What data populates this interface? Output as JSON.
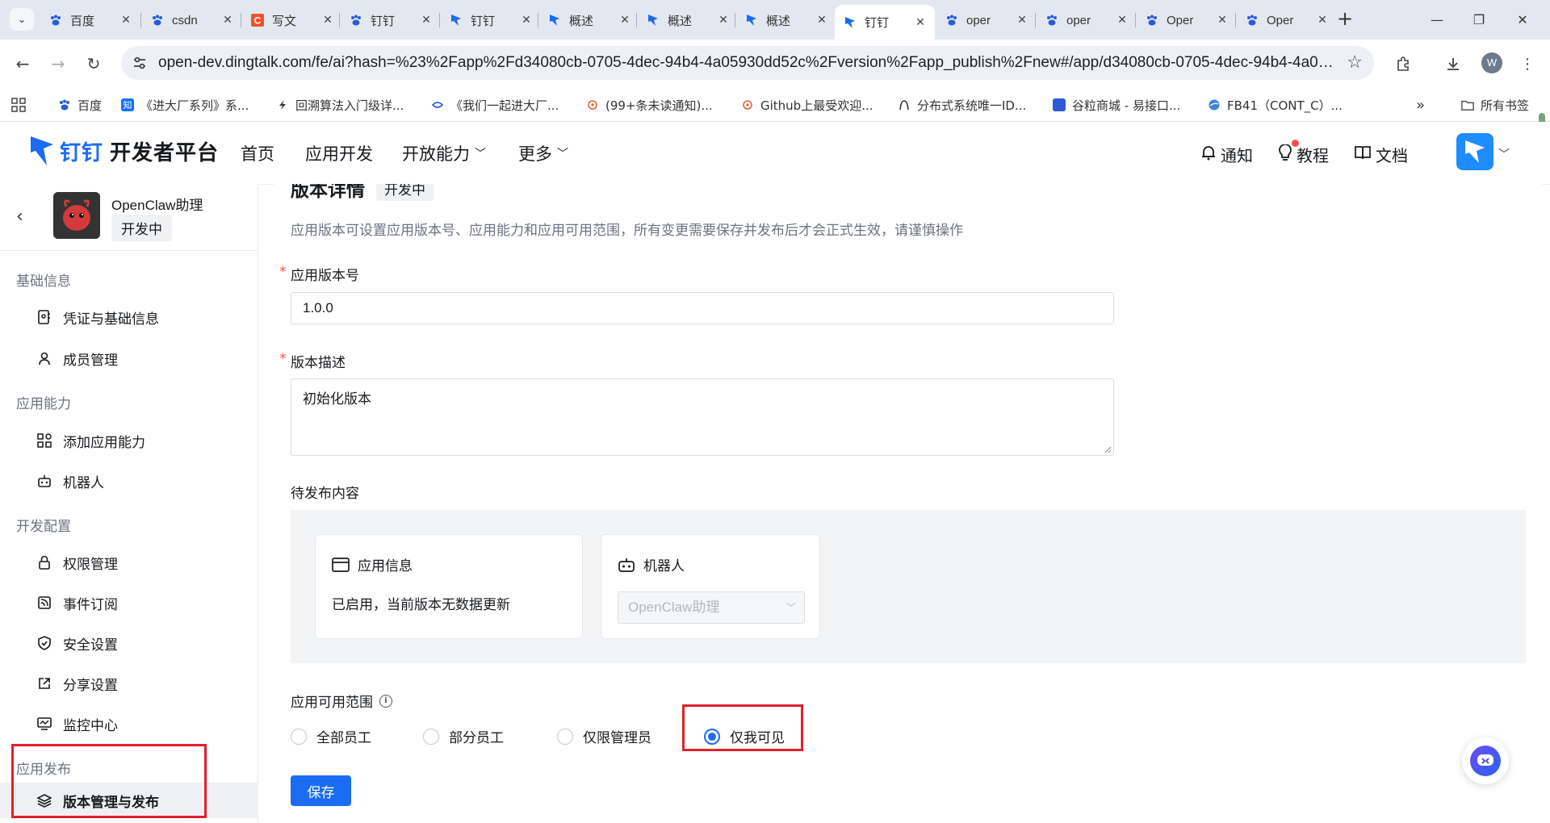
{
  "browser": {
    "tabs": [
      {
        "label": "百度",
        "icon": "baidu-paw-icon"
      },
      {
        "label": "csdn",
        "icon": "baidu-paw-icon"
      },
      {
        "label": "写文",
        "icon": "csdn-c-icon"
      },
      {
        "label": "钉钉",
        "icon": "baidu-paw-icon"
      },
      {
        "label": "钉钉",
        "icon": "dingtalk-icon"
      },
      {
        "label": "概述",
        "icon": "dingtalk-icon"
      },
      {
        "label": "概述",
        "icon": "dingtalk-icon"
      },
      {
        "label": "概述",
        "icon": "dingtalk-icon"
      },
      {
        "label": "钉钉",
        "icon": "dingtalk-icon",
        "active": true
      },
      {
        "label": "oper",
        "icon": "baidu-paw-icon"
      },
      {
        "label": "oper",
        "icon": "baidu-paw-icon"
      },
      {
        "label": "Oper",
        "icon": "baidu-paw-icon"
      },
      {
        "label": "Oper",
        "icon": "baidu-paw-icon"
      }
    ],
    "url": "open-dev.dingtalk.com/fe/ai?hash=%23%2Fapp%2Fd34080cb-0705-4dec-94b4-4a05930dd52c%2Fversion%2Fapp_publish%2Fnew#/app/d34080cb-0705-4dec-94b4-4a05...",
    "profile_initial": "W",
    "bookmarks": [
      {
        "label": "百度",
        "icon": "baidu-paw-icon"
      },
      {
        "label": "《进大厂系列》系...",
        "icon": "zhihu-icon",
        "prefix": "知"
      },
      {
        "label": "回溯算法入门级详...",
        "icon": "bookmark-favicon"
      },
      {
        "label": "《我们一起进大厂...",
        "icon": "bookmark-favicon"
      },
      {
        "label": "(99+条未读通知)...",
        "icon": "bookmark-favicon"
      },
      {
        "label": "Github上最受欢迎...",
        "icon": "bookmark-favicon"
      },
      {
        "label": "分布式系统唯一ID...",
        "icon": "bookmark-favicon"
      },
      {
        "label": "谷粒商城 - 易接口...",
        "icon": "bookmark-favicon"
      },
      {
        "label": "FB41（CONT_C）...",
        "icon": "bookmark-favicon"
      }
    ],
    "all_bookmarks": "所有书签"
  },
  "header": {
    "brand": "钉钉",
    "brand_sub": "开发者平台",
    "nav": [
      "首页",
      "应用开发",
      "开放能力",
      "更多"
    ],
    "notify": "通知",
    "tutorial": "教程",
    "docs": "文档"
  },
  "sidebar": {
    "app_name": "OpenClaw助理",
    "app_status": "开发中",
    "groups": {
      "basic": "基础信息",
      "capability": "应用能力",
      "dev": "开发配置",
      "publish": "应用发布"
    },
    "items": {
      "credentials": "凭证与基础信息",
      "members": "成员管理",
      "add_capability": "添加应用能力",
      "robot": "机器人",
      "permissions": "权限管理",
      "events": "事件订阅",
      "security": "安全设置",
      "share": "分享设置",
      "monitor": "监控中心",
      "version": "版本管理与发布"
    }
  },
  "main": {
    "title": "版本详情",
    "title_badge": "开发中",
    "description": "应用版本可设置应用版本号、应用能力和应用可用范围，所有变更需要保存并发布后才会正式生效，请谨慎操作",
    "version_label": "应用版本号",
    "version_value": "1.0.0",
    "desc_label": "版本描述",
    "desc_value": "初始化版本",
    "pending_label": "待发布内容",
    "card_info_title": "应用信息",
    "card_info_body": "已启用，当前版本无数据更新",
    "card_robot_title": "机器人",
    "card_robot_select": "OpenClaw助理",
    "scope_label": "应用可用范围",
    "scope_options": [
      "全部员工",
      "部分员工",
      "仅限管理员",
      "仅我可见"
    ],
    "scope_selected": "仅我可见",
    "save_label": "保存"
  },
  "colors": {
    "accent": "#1b6cf2",
    "highlight_box": "#e0202a"
  }
}
